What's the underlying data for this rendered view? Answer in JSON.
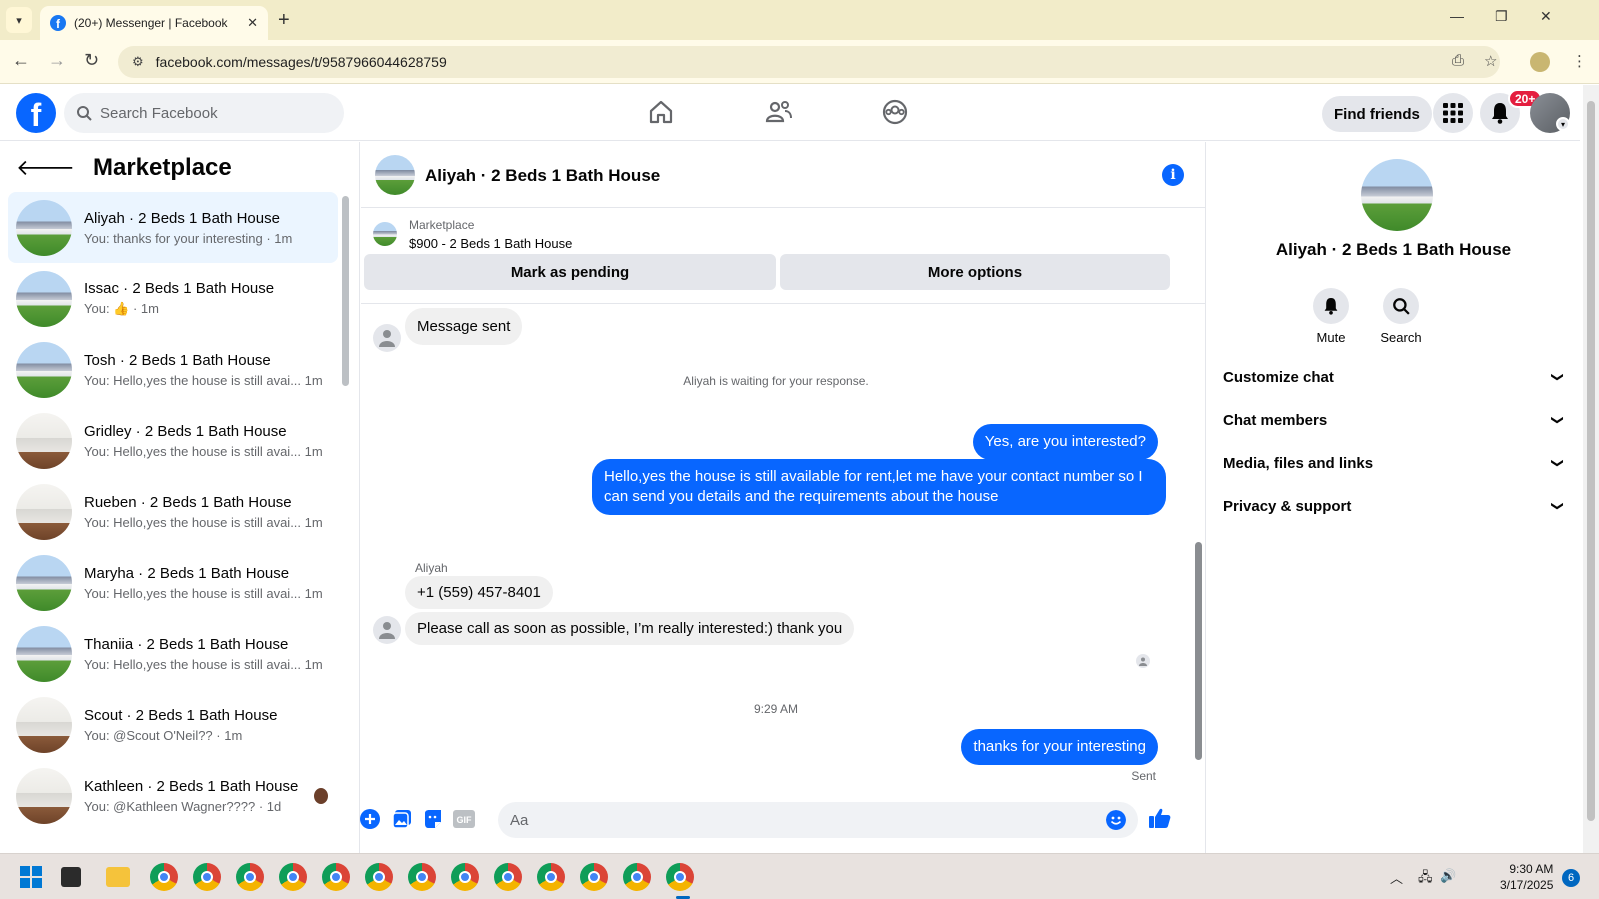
{
  "browser": {
    "tab_title": "(20+) Messenger | Facebook",
    "url": "facebook.com/messages/t/9587966044628759"
  },
  "fb_header": {
    "search_placeholder": "Search Facebook",
    "find_friends": "Find friends",
    "notif_badge": "20+",
    "nav_icons": [
      "home-icon",
      "friends-icon",
      "groups-icon"
    ]
  },
  "sidebar": {
    "title": "Marketplace",
    "conversations": [
      {
        "name": "Aliyah · 2 Beds 1 Bath House",
        "preview": "You: thanks for your interesting · 1m",
        "thumb": "house",
        "active": true
      },
      {
        "name": "Issac · 2 Beds 1 Bath House",
        "preview": "You: 👍 · 1m",
        "thumb": "house",
        "active": false
      },
      {
        "name": "Tosh · 2 Beds 1 Bath House",
        "preview": "You: Hello,yes the house is still avai... 1m",
        "thumb": "house",
        "active": false
      },
      {
        "name": "Gridley · 2 Beds 1 Bath House",
        "preview": "You: Hello,yes the house is still avai... 1m",
        "thumb": "interior",
        "active": false
      },
      {
        "name": "Rueben · 2 Beds 1 Bath House",
        "preview": "You: Hello,yes the house is still avai... 1m",
        "thumb": "interior",
        "active": false
      },
      {
        "name": "Maryha · 2 Beds 1 Bath House",
        "preview": "You: Hello,yes the house is still avai... 1m",
        "thumb": "house",
        "active": false
      },
      {
        "name": "Thaniia · 2 Beds 1 Bath House",
        "preview": "You: Hello,yes the house is still avai... 1m",
        "thumb": "house",
        "active": false
      },
      {
        "name": "Scout · 2 Beds 1 Bath House",
        "preview": "You: @Scout O'Neil?? · 1m",
        "thumb": "interior",
        "active": false
      },
      {
        "name": "Kathleen · 2 Beds 1 Bath House",
        "preview": "You: @Kathleen Wagner???? · 1d",
        "thumb": "interior",
        "active": false
      }
    ]
  },
  "chat": {
    "title": "Aliyah · 2 Beds 1 Bath House",
    "listing": {
      "source": "Marketplace",
      "summary": "$900 - 2 Beds 1 Bath House",
      "mark_pending": "Mark as pending",
      "more_options": "More options"
    },
    "messages": {
      "message_sent": "Message sent",
      "waiting_note": "Aliyah is waiting for your response.",
      "out_1": "Yes, are you interested?",
      "out_2": "Hello,yes the house is still available for rent,let me have your contact number   so I can send you details and the requirements about the house",
      "sender_name": "Aliyah",
      "in_1": "+1 (559) 457-8401",
      "in_2": "Please call as soon as possible, I’m really interested:) thank you",
      "timestamp": "9:29 AM",
      "out_3": "thanks for your interesting",
      "status": "Sent"
    },
    "composer_placeholder": "Aa"
  },
  "right_panel": {
    "name": "Aliyah · 2 Beds 1 Bath House",
    "mute": "Mute",
    "search": "Search",
    "sections": [
      "Customize chat",
      "Chat members",
      "Media, files and links",
      "Privacy & support"
    ]
  },
  "taskbar": {
    "time": "9:30 AM",
    "date": "3/17/2025",
    "notif_count": "6"
  },
  "colors": {
    "fb_blue": "#0866ff",
    "active_row": "#ebf5ff",
    "badge_red": "#e41e3f"
  }
}
